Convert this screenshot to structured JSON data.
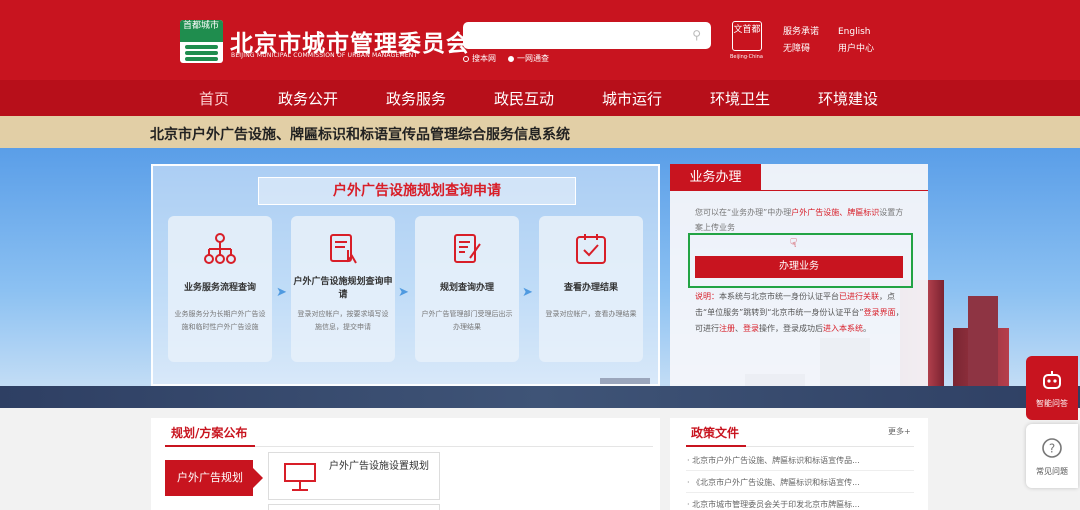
{
  "header": {
    "logo_text": "首都城市",
    "title": "北京市城市管理委员会",
    "subtitle": "BEIJING MUNICIPAL COMMISSION OF URBAN MANAGEMENT",
    "search_placeholder": "",
    "radio_site": "搜本网",
    "radio_portal": "一网通查",
    "seal_text": "文首都",
    "seal_sub": "Beijing·China",
    "links": [
      "服务承诺",
      "无障碍",
      "English",
      "用户中心"
    ]
  },
  "nav": {
    "items": [
      "首页",
      "政务公开",
      "政务服务",
      "政民互动",
      "城市运行",
      "环境卫生",
      "环境建设"
    ],
    "active": "首页"
  },
  "banner": {
    "title": "北京市户外广告设施、牌匾标识和标语宣传品管理综合服务信息系统"
  },
  "apply": {
    "title": "户外广告设施规划查询申请",
    "steps": [
      {
        "title": "业务服务流程查询",
        "desc": "业务服务分为长期户外广告设施和临时性户外广告设施"
      },
      {
        "title": "户外广告设施规划查询申请",
        "desc": "登录对应帐户，按要求填写设施信息，提交申请"
      },
      {
        "title": "规划查询办理",
        "desc": "户外广告管理部门受理后出示办理结果"
      },
      {
        "title": "查看办理结果",
        "desc": "登录对应帐户，查看办理结果"
      }
    ]
  },
  "business": {
    "tab": "业务办理",
    "desc_1": "您可以在“业务办理”中办理",
    "desc_red": "户外广告设施、牌匾标识",
    "desc_2": "设置方案上传业务",
    "button": "办理业务",
    "note_label": "说明：",
    "note_1": "本系统与北京市统一身份认证平台",
    "note_red1": "已进行关联",
    "note_2": "，点击“单位服务”跳转到“北京市统一身份认证平台”",
    "note_red2": "登录界面",
    "note_3": "，可进行",
    "note_red3": "注册",
    "note_4": "、",
    "note_red4": "登录",
    "note_5": "操作，登录成功后",
    "note_red5": "进入本系统",
    "note_6": "。"
  },
  "side": {
    "robot": "智能问答",
    "faq": "常见问题"
  },
  "plan": {
    "title": "规划/方案公布",
    "tab": "户外广告规划",
    "card_text": "户外广告设施设置规划"
  },
  "policy": {
    "title": "政策文件",
    "more": "更多+",
    "items": [
      "北京市户外广告设施、牌匾标识和标语宣传品...",
      "《北京市户外广告设施、牌匾标识和标语宣传...",
      "北京市城市管理委员会关于印发北京市牌匾标..."
    ]
  },
  "colors": {
    "brand_red": "#c8141f",
    "highlight_green": "#22a344",
    "banner_tan": "#e2cfa6"
  }
}
